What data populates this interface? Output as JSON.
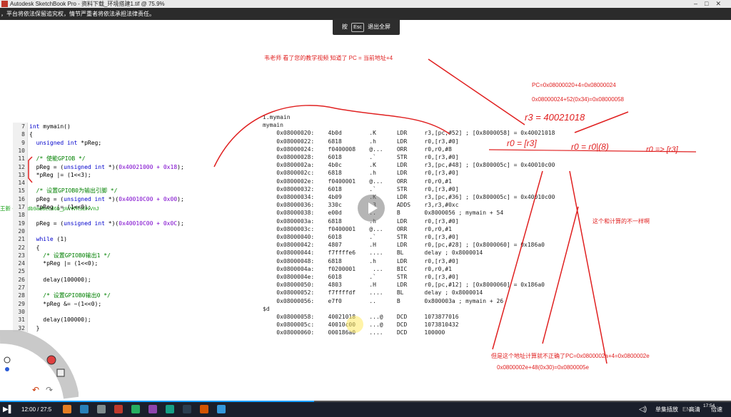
{
  "window": {
    "title": "Autodesk SketchBook Pro - 资料下载_环境搭建1.tif @ 75.9%"
  },
  "notice": "，平台将依法保留追究权，情节严重者将依法承担法律责任。",
  "fullscreen_hint": {
    "prefix": "按",
    "key": "Esc",
    "suffix": "退出全屏"
  },
  "side_label": "王新 - u_5edb9ad6ecd6b_pWWRsEKVnJ",
  "code": {
    "lines": [
      {
        "n": "7",
        "parts": [
          [
            "kw",
            "int "
          ],
          [
            "tx",
            "mymain()"
          ]
        ]
      },
      {
        "n": "8",
        "parts": [
          [
            "tx",
            "{"
          ]
        ]
      },
      {
        "n": "9",
        "parts": [
          [
            "kw",
            "  unsigned int "
          ],
          [
            "tx",
            "*pReg;"
          ]
        ]
      },
      {
        "n": "10",
        "parts": [
          [
            "tx",
            ""
          ]
        ]
      },
      {
        "n": "11",
        "parts": [
          [
            "cm",
            "  /* 使能GPIOB */"
          ]
        ]
      },
      {
        "n": "12",
        "parts": [
          [
            "tx",
            "  pReg = ("
          ],
          [
            "kw",
            "unsigned int "
          ],
          [
            "tx",
            "*)("
          ],
          [
            "nm",
            "0x40021000 + 0x18"
          ],
          [
            "tx",
            ");"
          ]
        ]
      },
      {
        "n": "13",
        "parts": [
          [
            "tx",
            "  *pReg |= (1<<3);"
          ]
        ]
      },
      {
        "n": "14",
        "parts": [
          [
            "tx",
            ""
          ]
        ]
      },
      {
        "n": "15",
        "parts": [
          [
            "cm",
            "  /* 设置GPIOB0为输出引脚 */"
          ]
        ]
      },
      {
        "n": "16",
        "parts": [
          [
            "tx",
            "  pReg = ("
          ],
          [
            "kw",
            "unsigned int "
          ],
          [
            "tx",
            "*)("
          ],
          [
            "nm",
            "0x40010C00 + 0x00"
          ],
          [
            "tx",
            ");"
          ]
        ]
      },
      {
        "n": "17",
        "parts": [
          [
            "tx",
            "  *pReg |= (1<<0);"
          ]
        ]
      },
      {
        "n": "18",
        "parts": [
          [
            "tx",
            ""
          ]
        ]
      },
      {
        "n": "19",
        "parts": [
          [
            "tx",
            "  pReg = ("
          ],
          [
            "kw",
            "unsigned int "
          ],
          [
            "tx",
            "*)("
          ],
          [
            "nm",
            "0x40010C00 + 0x0C"
          ],
          [
            "tx",
            ");"
          ]
        ]
      },
      {
        "n": "20",
        "parts": [
          [
            "tx",
            ""
          ]
        ]
      },
      {
        "n": "21",
        "parts": [
          [
            "kw",
            "  while "
          ],
          [
            "tx",
            "(1)"
          ]
        ]
      },
      {
        "n": "22",
        "parts": [
          [
            "tx",
            "  {"
          ]
        ]
      },
      {
        "n": "23",
        "parts": [
          [
            "cm",
            "    /* 设置GPIOB0输出1 */"
          ]
        ]
      },
      {
        "n": "24",
        "parts": [
          [
            "tx",
            "    *pReg |= (1<<0);"
          ]
        ]
      },
      {
        "n": "25",
        "parts": [
          [
            "tx",
            ""
          ]
        ]
      },
      {
        "n": "26",
        "parts": [
          [
            "tx",
            "    delay(100000);"
          ]
        ]
      },
      {
        "n": "27",
        "parts": [
          [
            "tx",
            ""
          ]
        ]
      },
      {
        "n": "28",
        "parts": [
          [
            "cm",
            "    /* 设置GPIOB0输出0 */"
          ]
        ]
      },
      {
        "n": "29",
        "parts": [
          [
            "tx",
            "    *pReg &= ~(1<<0);"
          ]
        ]
      },
      {
        "n": "30",
        "parts": [
          [
            "tx",
            ""
          ]
        ]
      },
      {
        "n": "31",
        "parts": [
          [
            "tx",
            "    delay(100000);"
          ]
        ]
      },
      {
        "n": "32",
        "parts": [
          [
            "tx",
            "  }"
          ]
        ]
      }
    ]
  },
  "asm": {
    "lines": [
      "i.mymain",
      "mymain",
      "    0x08000020:    4b0d        .K      LDR     r3,[pc,#52] ; [0x8000058] = 0x40021018",
      "    0x08000022:    6818        .h      LDR     r0,[r3,#0]",
      "    0x08000024:    f0400008    @...    ORR     r0,r0,#8",
      "    0x08000028:    6018        .`      STR     r0,[r3,#0]",
      "    0x0800002a:    4b0c        .K      LDR     r3,[pc,#48] ; [0x800005c] = 0x40010c00",
      "    0x0800002c:    6818        .h      LDR     r0,[r3,#0]",
      "    0x0800002e:    f0400001    @...    ORR     r0,r0,#1",
      "    0x08000032:    6018        .`      STR     r0,[r3,#0]",
      "    0x08000034:    4b09        .K      LDR     r3,[pc,#36] ; [0x800005c] = 0x40010c00",
      "    0x08000036:    330c        .3      ADDS    r3,r3,#0xc",
      "    0x08000038:    e00d        ..      B       0x8000056 ; mymain + 54",
      "    0x0800003a:    6818        .h      LDR     r0,[r3,#0]",
      "    0x0800003c:    f0400001    @...    ORR     r0,r0,#1",
      "    0x08000040:    6018        .`      STR     r0,[r3,#0]",
      "    0x08000042:    4807        .H      LDR     r0,[pc,#28] ; [0x8000060] = 0x186a0",
      "    0x08000044:    f7ffffe6    ....    BL      delay ; 0x8000014",
      "    0x08000048:    6818        .h      LDR     r0,[r3,#0]",
      "    0x0800004a:    f0200001     ...    BIC     r0,r0,#1",
      "    0x0800004e:    6018        .`      STR     r0,[r3,#0]",
      "    0x08000050:    4803        .H      LDR     r0,[pc,#12] ; [0x8000060] = 0x186a0",
      "    0x08000052:    f7ffffdf    ....    BL      delay ; 0x8000014",
      "    0x08000056:    e7f0        ..      B       0x800003a ; mymain + 26",
      "$d",
      "    0x08000058:    40021018    ...@    DCD     1073877016",
      "    0x0800005c:    40010c00    ...@    DCD     1073810432",
      "    0x08000060:    000186a0    ....    DCD     100000"
    ]
  },
  "annotations": {
    "question": "韦老师  看了您的教学视频  知道了  PC  =  当前地址+4",
    "calc1": "PC=0x08000020+4=0x08000024",
    "calc2": "0x08000024+52(0x34)=0x08000058",
    "hand_r3": "r3 = 40021018",
    "hand_r0": "r0 = [r3]",
    "hand_r0b": "r0 = r0|(8)",
    "hand_r0c": "r0 => [r3]",
    "diff": "这个和计算的不一样啊",
    "bottom1": "但是这个地址计算就不正确了PC=0x0800002a+4=0x0800002e",
    "bottom2": "0x0800002e+48(0x30)=0x0800005e"
  },
  "player": {
    "time": "12:00 / 27:5",
    "quality": "单集插放",
    "hd": "高清",
    "speed": "倍速",
    "fps": "EN",
    "clock": "17:54",
    "progress": 0.43
  },
  "colors": {
    "annotation": "#e02020",
    "accent": "#1aa2ff"
  }
}
